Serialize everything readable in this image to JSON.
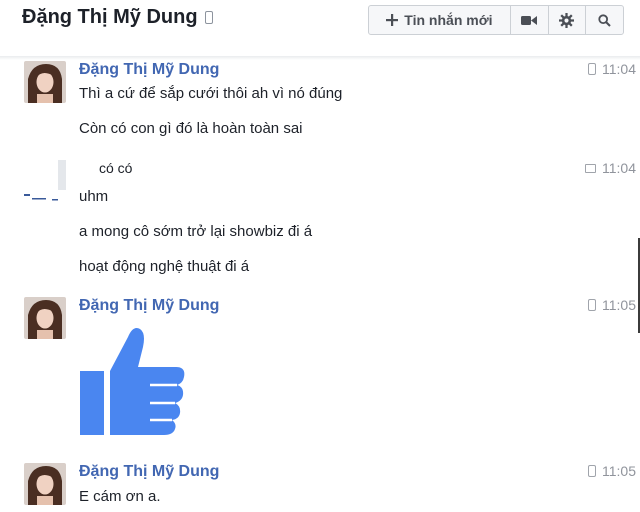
{
  "header": {
    "title": "Đặng Thị Mỹ Dung",
    "new_message_label": "Tin nhắn mới"
  },
  "messages": [
    {
      "sender": "Đặng Thị Mỹ Dung",
      "time": "11:04",
      "lines": [
        "Thì a cứ để sắp cưới thôi ah vì nó đúng",
        "Còn có con gì đó là hoàn toàn sai"
      ]
    },
    {
      "sender": "",
      "time": "11:04",
      "preview": "có có",
      "lines": [
        "uhm",
        "a mong cô sớm trở lại showbiz đi á",
        "hoạt động nghệ thuật đi á"
      ]
    },
    {
      "sender": "Đặng Thị Mỹ Dung",
      "time": "11:05",
      "sticker": "thumbs-up"
    },
    {
      "sender": "Đặng Thị Mỹ Dung",
      "time": "11:05",
      "lines": [
        "E cám ơn a."
      ]
    }
  ],
  "colors": {
    "sender_name": "#4267b2",
    "thumb": "#4a86f0",
    "timestamp": "#90949c"
  }
}
